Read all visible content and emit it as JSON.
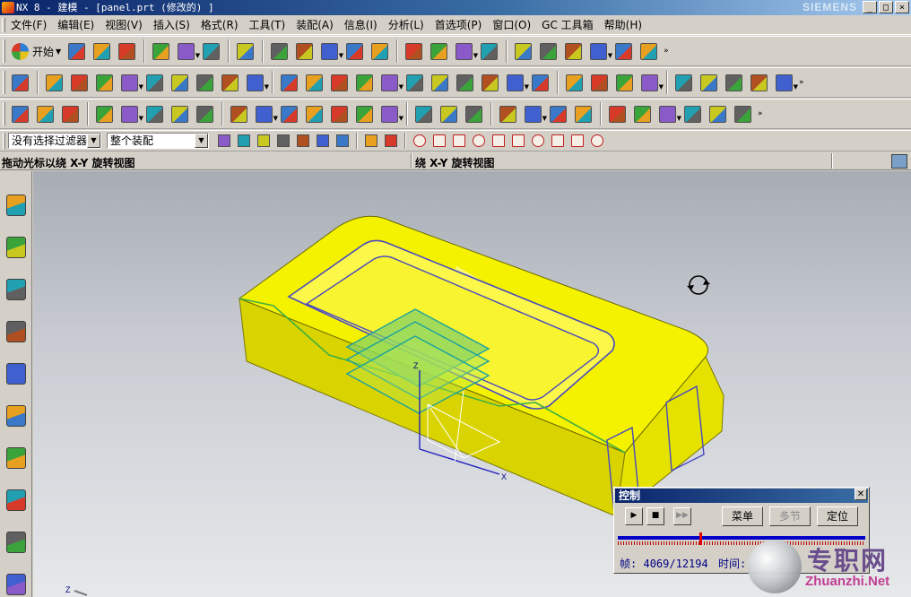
{
  "window": {
    "title": "NX 8 - 建模 - [panel.prt (修改的) ]",
    "brand": "SIEMENS",
    "buttons": [
      "_",
      "□",
      "×"
    ]
  },
  "menubar": {
    "items": [
      "文件(F)",
      "编辑(E)",
      "视图(V)",
      "插入(S)",
      "格式(R)",
      "工具(T)",
      "装配(A)",
      "信息(I)",
      "分析(L)",
      "首选项(P)",
      "窗口(O)",
      "GC 工具箱",
      "帮助(H)"
    ]
  },
  "toolbar": {
    "start_label": "开始",
    "row1_icons": [
      "new-file",
      "open-folder",
      "save",
      "cut",
      "copy",
      "paste",
      "undo",
      "fit-view",
      "render-style",
      "shaded-cube",
      "view-triad",
      "wireframe-cube",
      "section-cube",
      "background-color",
      "orient-view",
      "camera-view",
      "layer-settings",
      "wcs-tool",
      "snap-tool",
      "motion-tool",
      "measure-distance",
      "measure-angle"
    ],
    "row2_icons": [
      "sketch",
      "extrude",
      "revolve",
      "block",
      "cylinder",
      "sphere",
      "edge-blend",
      "chamfer",
      "shell",
      "datum-plane",
      "thicken",
      "unite",
      "subtract",
      "intersect",
      "mirror",
      "pattern",
      "offset-face",
      "sew",
      "trim-body",
      "split-body",
      "surface",
      "ruled",
      "through-curves",
      "extension",
      "point-set",
      "boolean-add",
      "boolean-pattern",
      "assembly-add",
      "surface-a",
      "surface-b"
    ],
    "row3_icons": [
      "csys",
      "layer-1",
      "layer-2",
      "tag",
      "instance-1",
      "instance-2",
      "instance-3",
      "dimension",
      "smooth-1",
      "smooth-2",
      "g0",
      "g1",
      "g2",
      "g3",
      "dialog",
      "spring",
      "coil",
      "tool-x",
      "check",
      "analysis-1",
      "analysis-2",
      "analysis-3",
      "rewind",
      "step-back",
      "step-forward",
      "fast-forward",
      "record",
      "quick"
    ]
  },
  "selbar": {
    "filter_value": "没有选择过滤器",
    "scope_value": "整个装配",
    "icons": [
      "select-options",
      "general-filter",
      "undo-select",
      "snap-vertex",
      "snap-edge",
      "snap-face",
      "box-select",
      "select-more",
      "select-all",
      "snap-end",
      "snap-mid",
      "snap-curve",
      "snap-arc",
      "snap-center",
      "snap-quadrant",
      "snap-point",
      "snap-pole",
      "snap-intersection",
      "snap-view"
    ]
  },
  "cueline": {
    "cue": "拖动光标以绕 X-Y 旋转视图",
    "status": "绕 X-Y 旋转视图"
  },
  "resource_bar": {
    "icons": [
      "assembly-navigator",
      "constraint-navigator",
      "part-navigator",
      "reuse-library",
      "hd3d-tools",
      "web-browser",
      "history",
      "system-materials",
      "process-studio",
      "roles"
    ]
  },
  "graphics": {
    "axis_labels": [
      "Z",
      "Y",
      "X"
    ]
  },
  "control_dialog": {
    "title": "控制",
    "play_buttons": [
      "▶",
      "■",
      "▶▶"
    ],
    "menu_label": "菜单",
    "multi_label": "多节",
    "position_label": "定位",
    "frame_label": "帧:",
    "frame_value": "4069/12194",
    "time_label": "时间:",
    "slider_fraction": 0.334
  },
  "watermark": {
    "cn": "专职网",
    "en": "Zhuanzhi.Net"
  },
  "colors": {
    "part_top": "#f5f200",
    "part_side": "#d4d000",
    "edge": "#3030b0",
    "datum": "#19a0a0"
  }
}
